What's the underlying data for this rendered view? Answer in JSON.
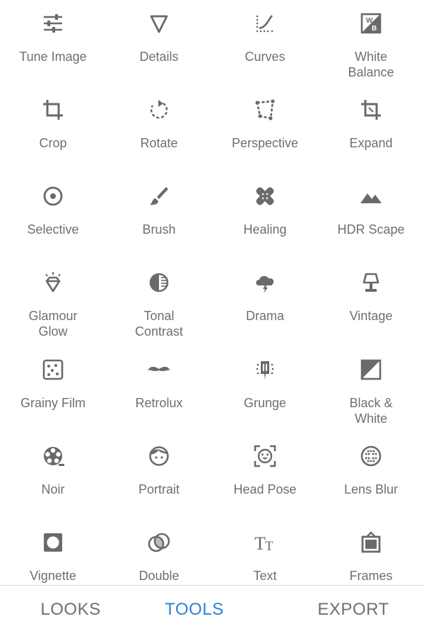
{
  "tools": [
    {
      "label": "Tune Image",
      "icon": "tune-image-icon"
    },
    {
      "label": "Details",
      "icon": "details-icon"
    },
    {
      "label": "Curves",
      "icon": "curves-icon"
    },
    {
      "label": "White\nBalance",
      "icon": "white-balance-icon"
    },
    {
      "label": "Crop",
      "icon": "crop-icon"
    },
    {
      "label": "Rotate",
      "icon": "rotate-icon"
    },
    {
      "label": "Perspective",
      "icon": "perspective-icon"
    },
    {
      "label": "Expand",
      "icon": "expand-icon"
    },
    {
      "label": "Selective",
      "icon": "selective-icon"
    },
    {
      "label": "Brush",
      "icon": "brush-icon"
    },
    {
      "label": "Healing",
      "icon": "healing-icon"
    },
    {
      "label": "HDR Scape",
      "icon": "hdr-scape-icon"
    },
    {
      "label": "Glamour\nGlow",
      "icon": "glamour-glow-icon"
    },
    {
      "label": "Tonal\nContrast",
      "icon": "tonal-contrast-icon"
    },
    {
      "label": "Drama",
      "icon": "drama-icon"
    },
    {
      "label": "Vintage",
      "icon": "vintage-icon"
    },
    {
      "label": "Grainy Film",
      "icon": "grainy-film-icon"
    },
    {
      "label": "Retrolux",
      "icon": "retrolux-icon"
    },
    {
      "label": "Grunge",
      "icon": "grunge-icon"
    },
    {
      "label": "Black &\nWhite",
      "icon": "black-white-icon"
    },
    {
      "label": "Noir",
      "icon": "noir-icon"
    },
    {
      "label": "Portrait",
      "icon": "portrait-icon"
    },
    {
      "label": "Head Pose",
      "icon": "head-pose-icon"
    },
    {
      "label": "Lens Blur",
      "icon": "lens-blur-icon"
    },
    {
      "label": "Vignette",
      "icon": "vignette-icon"
    },
    {
      "label": "Double",
      "icon": "double-exposure-icon"
    },
    {
      "label": "Text",
      "icon": "text-icon"
    },
    {
      "label": "Frames",
      "icon": "frames-icon"
    }
  ],
  "nav": {
    "looks": "LOOKS",
    "tools": "TOOLS",
    "export": "EXPORT",
    "active": "tools"
  },
  "colors": {
    "icon": "#6a6a6a",
    "label": "#6f6f6f",
    "active": "#2f80d6",
    "background": "#ffffff"
  }
}
